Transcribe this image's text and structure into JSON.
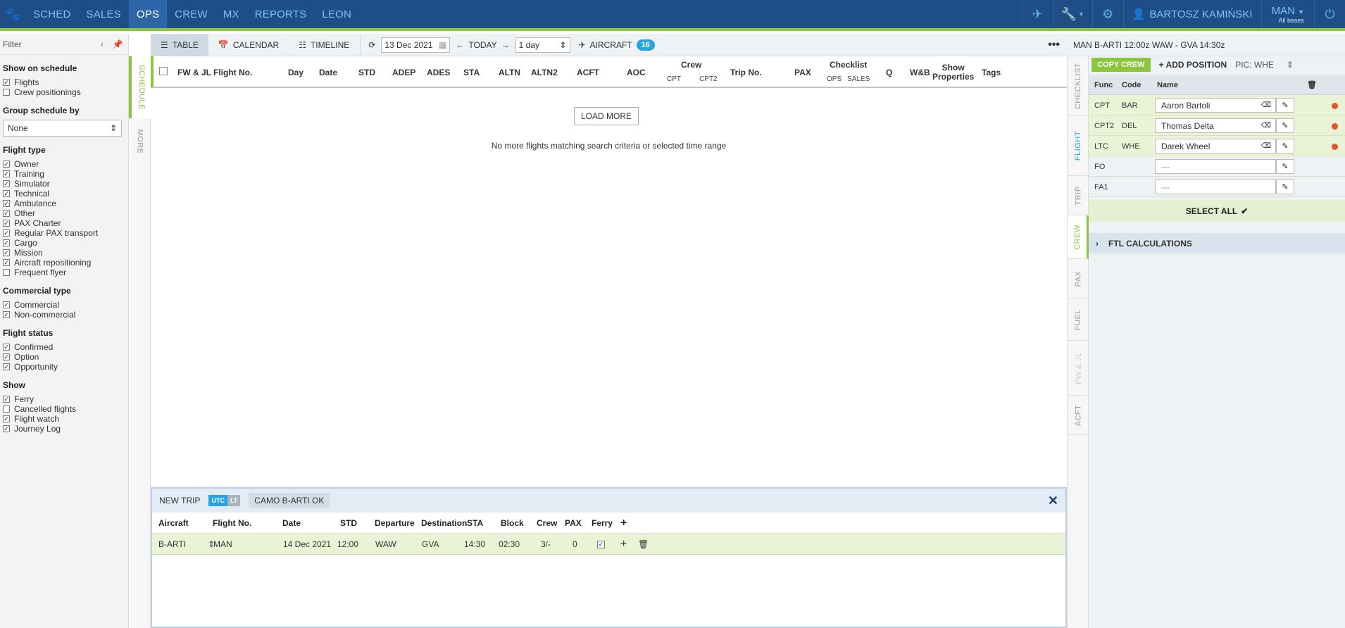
{
  "topnav": {
    "items": [
      {
        "label": "SCHED",
        "active": false
      },
      {
        "label": "SALES",
        "active": false
      },
      {
        "label": "OPS",
        "active": true
      },
      {
        "label": "CREW",
        "active": false
      },
      {
        "label": "MX",
        "active": false
      },
      {
        "label": "REPORTS",
        "active": false
      },
      {
        "label": "LEON",
        "active": false
      }
    ],
    "user_name": "BARTOSZ KAMIŃSKI",
    "base": "MAN",
    "base_sub": "All bases",
    "icons": [
      "paw-icon",
      "plane-icon",
      "wrench-icon",
      "gear-icon",
      "user-icon",
      "power-icon"
    ]
  },
  "filter": {
    "title": "Filter",
    "show_on_schedule": {
      "title": "Show on schedule",
      "items": [
        {
          "label": "Flights",
          "checked": true
        },
        {
          "label": "Crew positionings",
          "checked": false
        }
      ]
    },
    "group_by": {
      "title": "Group schedule by",
      "value": "None"
    },
    "flight_type": {
      "title": "Flight type",
      "items": [
        {
          "label": "Owner",
          "checked": true
        },
        {
          "label": "Training",
          "checked": true
        },
        {
          "label": "Simulator",
          "checked": true
        },
        {
          "label": "Technical",
          "checked": true
        },
        {
          "label": "Ambulance",
          "checked": true
        },
        {
          "label": "Other",
          "checked": true
        },
        {
          "label": "PAX Charter",
          "checked": true
        },
        {
          "label": "Regular PAX transport",
          "checked": true
        },
        {
          "label": "Cargo",
          "checked": true
        },
        {
          "label": "Mission",
          "checked": true
        },
        {
          "label": "Aircraft repositioning",
          "checked": true
        },
        {
          "label": "Frequent flyer",
          "checked": false
        }
      ]
    },
    "commercial_type": {
      "title": "Commercial type",
      "items": [
        {
          "label": "Commercial",
          "checked": true
        },
        {
          "label": "Non-commercial",
          "checked": true
        }
      ]
    },
    "flight_status": {
      "title": "Flight status",
      "items": [
        {
          "label": "Confirmed",
          "checked": true
        },
        {
          "label": "Option",
          "checked": true
        },
        {
          "label": "Opportunity",
          "checked": true
        }
      ]
    },
    "show": {
      "title": "Show",
      "items": [
        {
          "label": "Ferry",
          "checked": true
        },
        {
          "label": "Cancelled flights",
          "checked": false
        },
        {
          "label": "Flight watch",
          "checked": true
        },
        {
          "label": "Journey Log",
          "checked": true
        }
      ]
    }
  },
  "left_tabs": {
    "schedule": "SCHEDULE",
    "more": "MORE"
  },
  "toolbar": {
    "table": "TABLE",
    "calendar": "CALENDAR",
    "timeline": "TIMELINE",
    "date": "13 Dec 2021",
    "today": "TODAY",
    "range": "1 day",
    "aircraft": "AIRCRAFT",
    "aircraft_count": "16",
    "more": "•••"
  },
  "table_headers": {
    "fw_jl": "FW & JL",
    "flight_no": "Flight No.",
    "day": "Day",
    "date": "Date",
    "std": "STD",
    "adep": "ADEP",
    "ades": "ADES",
    "sta": "STA",
    "altn": "ALTN",
    "altn2": "ALTN2",
    "acft": "ACFT",
    "aoc": "AOC",
    "crew": "Crew",
    "crew_cpt": "CPT",
    "crew_cpt2": "CPT2",
    "trip_no": "Trip No.",
    "pax": "PAX",
    "checklist": "Checklist",
    "checklist_ops": "OPS",
    "checklist_sales": "SALES",
    "q": "Q",
    "wb": "W&B",
    "show_properties_1": "Show",
    "show_properties_2": "Properties",
    "tags": "Tags"
  },
  "content": {
    "load_more": "LOAD MORE",
    "no_more": "No more flights matching search criteria or selected time range"
  },
  "new_trip": {
    "title": "NEW TRIP",
    "utc": "UTC",
    "lt": "LT",
    "camo": "CAMO B-ARTI OK",
    "headers": {
      "aircraft": "Aircraft",
      "flight_no": "Flight No.",
      "date": "Date",
      "std": "STD",
      "departure": "Departure",
      "destination": "Destination",
      "sta": "STA",
      "block": "Block",
      "crew": "Crew",
      "pax": "PAX",
      "ferry": "Ferry"
    },
    "row": {
      "aircraft": "B-ARTI",
      "flight_no": "MAN",
      "date": "14 Dec 2021",
      "std": "12:00",
      "departure": "WAW",
      "destination": "GVA",
      "sta": "14:30",
      "block": "02:30",
      "crew": "3/-",
      "pax": "0",
      "ferry": true
    }
  },
  "right_tabs": [
    "CHECKLIST",
    "FLIGHT",
    "TRIP",
    "CREW",
    "PAX",
    "FUEL",
    "FW & JL",
    "ACFT"
  ],
  "right_panel": {
    "header": "MAN B-ARTI 12:00z WAW - GVA 14:30z",
    "copy_crew": "COPY CREW",
    "add_position": "ADD POSITION",
    "pic": "PIC: WHE",
    "headers": {
      "func": "Func",
      "code": "Code",
      "name": "Name"
    },
    "crew": [
      {
        "func": "CPT",
        "code": "BAR",
        "name": "Aaron Bartoli",
        "assigned": true
      },
      {
        "func": "CPT2",
        "code": "DEL",
        "name": "Thomas Delta",
        "assigned": true
      },
      {
        "func": "LTC",
        "code": "WHE",
        "name": "Darek Wheel",
        "assigned": true
      },
      {
        "func": "FO",
        "code": "",
        "name": "---",
        "assigned": false
      },
      {
        "func": "FA1",
        "code": "",
        "name": "---",
        "assigned": false
      }
    ],
    "select_all": "SELECT ALL",
    "ftl": "FTL CALCULATIONS"
  },
  "colors": {
    "nav_bg": "#1f4e87",
    "accent_green": "#8cc63f",
    "accent_blue": "#29a3e0",
    "alert_red": "#e2542b"
  }
}
